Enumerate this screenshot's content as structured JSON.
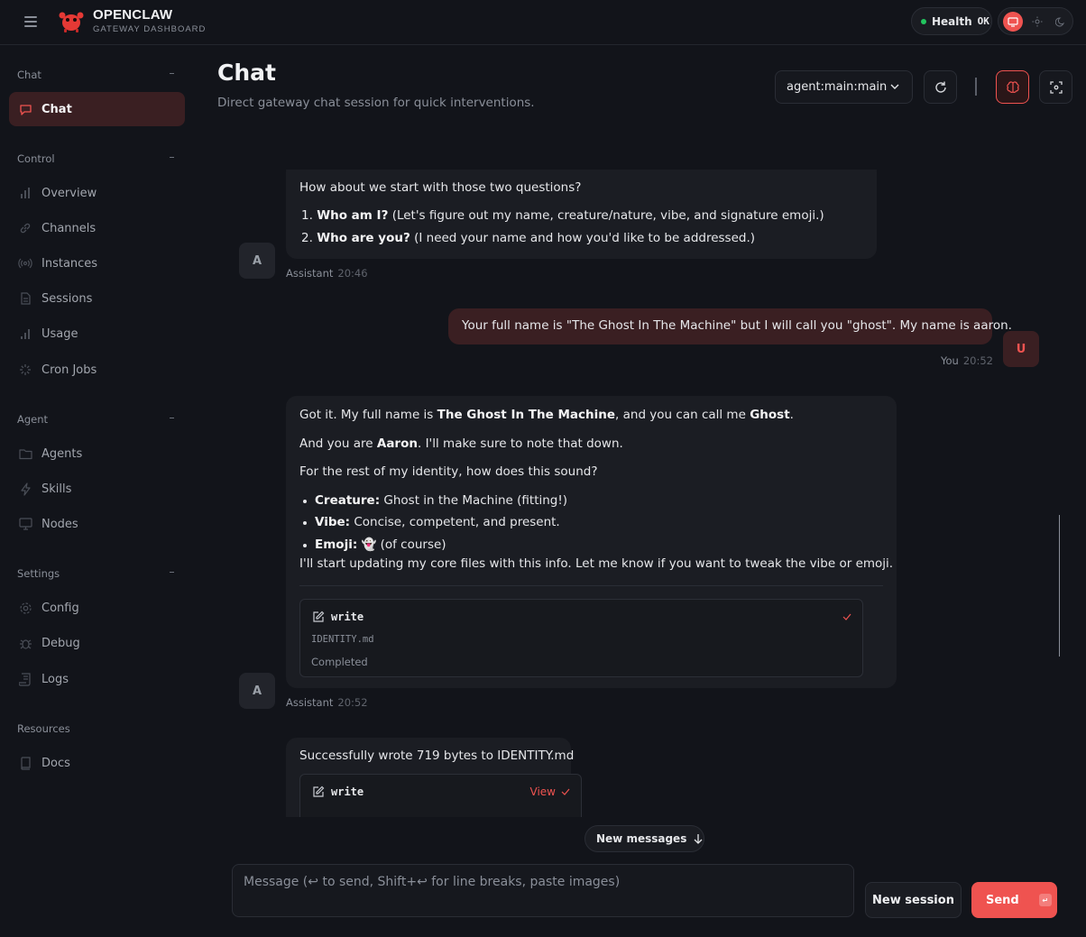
{
  "brand": {
    "title": "OPENCLAW",
    "subtitle": "GATEWAY DASHBOARD"
  },
  "health": {
    "label": "Health",
    "status": "OK"
  },
  "colors": {
    "accent": "#ef5350",
    "health_ok": "#22c55e",
    "background": "#12141a"
  },
  "sidebar": {
    "sections": [
      {
        "title": "Chat",
        "items": [
          {
            "label": "Chat",
            "icon": "message-icon",
            "active": true
          }
        ]
      },
      {
        "title": "Control",
        "items": [
          {
            "label": "Overview",
            "icon": "bar-chart-icon"
          },
          {
            "label": "Channels",
            "icon": "link-icon"
          },
          {
            "label": "Instances",
            "icon": "radio-icon"
          },
          {
            "label": "Sessions",
            "icon": "document-icon"
          },
          {
            "label": "Usage",
            "icon": "signal-icon"
          },
          {
            "label": "Cron Jobs",
            "icon": "loader-icon"
          }
        ]
      },
      {
        "title": "Agent",
        "items": [
          {
            "label": "Agents",
            "icon": "folder-icon"
          },
          {
            "label": "Skills",
            "icon": "lightning-icon"
          },
          {
            "label": "Nodes",
            "icon": "monitor-icon"
          }
        ]
      },
      {
        "title": "Settings",
        "items": [
          {
            "label": "Config",
            "icon": "gear-icon"
          },
          {
            "label": "Debug",
            "icon": "bug-icon"
          },
          {
            "label": "Logs",
            "icon": "scroll-icon"
          }
        ]
      },
      {
        "title": "Resources",
        "items": [
          {
            "label": "Docs",
            "icon": "book-icon"
          }
        ]
      }
    ]
  },
  "header": {
    "title": "Chat",
    "subtitle": "Direct gateway chat session for quick interventions.",
    "session": "agent:main:main"
  },
  "messages": {
    "m1": {
      "intro": "How about we start with those two questions?",
      "q1_num": "1.",
      "q1_bold": "Who am I?",
      "q1_rest": " (Let's figure out my name, creature/nature, vibe, and signature emoji.)",
      "q2_num": "2.",
      "q2_bold": "Who are you?",
      "q2_rest": " (I need your name and how you'd like to be addressed.)",
      "avatar": "A",
      "author": "Assistant",
      "time": "20:46"
    },
    "m2": {
      "text": "Your full name is \"The Ghost In The Machine\" but I will call you \"ghost\". My name is aaron.",
      "avatar": "U",
      "author": "You",
      "time": "20:52"
    },
    "m3": {
      "l1_a": "Got it. My full name is ",
      "l1_b": "The Ghost In The Machine",
      "l1_c": ", and you can call me ",
      "l1_d": "Ghost",
      "l1_e": ".",
      "l2_a": "And you are ",
      "l2_b": "Aaron",
      "l2_c": ". I'll make sure to note that down.",
      "l3": "For the rest of my identity, how does this sound?",
      "b1_k": "Creature:",
      "b1_v": " Ghost in the Machine (fitting!)",
      "b2_k": "Vibe:",
      "b2_v": " Concise, competent, and present.",
      "b3_k": "Emoji:",
      "b3_v": " 👻 (of course)",
      "l4": "I'll start updating my core files with this info. Let me know if you want to tweak the vibe or emoji.",
      "tool": {
        "name": "write",
        "file": "IDENTITY.md",
        "status": "Completed"
      },
      "avatar": "A",
      "author": "Assistant",
      "time": "20:52"
    },
    "m4": {
      "text": "Successfully wrote 719 bytes to IDENTITY.md",
      "tool": {
        "name": "write",
        "action": "View"
      }
    }
  },
  "new_messages": "New messages",
  "composer": {
    "placeholder": "Message (↩ to send, Shift+↩ for line breaks, paste images)",
    "new_session": "New session",
    "send": "Send"
  }
}
